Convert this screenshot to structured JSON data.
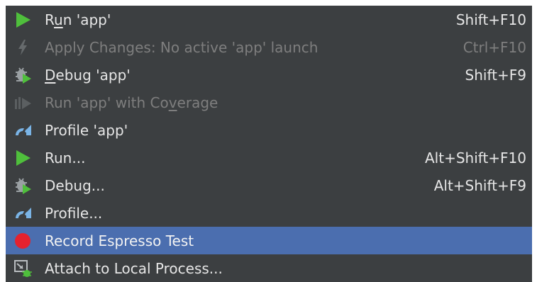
{
  "menu": {
    "items": [
      {
        "name": "run-app",
        "icon": "run-icon",
        "pre": "R",
        "mnemonic": "u",
        "post": "n 'app'",
        "shortcut": "Shift+F10",
        "disabled": false,
        "selected": false
      },
      {
        "name": "apply-changes",
        "icon": "apply-changes-icon",
        "pre": "Apply Changes: No active 'app' launch",
        "mnemonic": "",
        "post": "",
        "shortcut": "Ctrl+F10",
        "disabled": true,
        "selected": false
      },
      {
        "name": "debug-app",
        "icon": "debug-icon",
        "pre": "",
        "mnemonic": "D",
        "post": "ebug 'app'",
        "shortcut": "Shift+F9",
        "disabled": false,
        "selected": false
      },
      {
        "name": "run-with-coverage",
        "icon": "coverage-icon",
        "pre": "Run 'app' with Co",
        "mnemonic": "v",
        "post": "erage",
        "shortcut": "",
        "disabled": true,
        "selected": false
      },
      {
        "name": "profile-app",
        "icon": "profile-icon",
        "pre": "Profile 'app'",
        "mnemonic": "",
        "post": "",
        "shortcut": "",
        "disabled": false,
        "selected": false
      },
      {
        "name": "run-dots",
        "icon": "run-icon",
        "pre": "Run...",
        "mnemonic": "",
        "post": "",
        "shortcut": "Alt+Shift+F10",
        "disabled": false,
        "selected": false
      },
      {
        "name": "debug-dots",
        "icon": "debug-icon",
        "pre": "Debug...",
        "mnemonic": "",
        "post": "",
        "shortcut": "Alt+Shift+F9",
        "disabled": false,
        "selected": false
      },
      {
        "name": "profile-dots",
        "icon": "profile-icon",
        "pre": "Profile...",
        "mnemonic": "",
        "post": "",
        "shortcut": "",
        "disabled": false,
        "selected": false
      },
      {
        "name": "record-espresso-test",
        "icon": "record-icon",
        "pre": "Record Espresso Test",
        "mnemonic": "",
        "post": "",
        "shortcut": "",
        "disabled": false,
        "selected": true
      },
      {
        "name": "attach-to-local-process",
        "icon": "attach-process-icon",
        "pre": "Attach to Local Process...",
        "mnemonic": "",
        "post": "",
        "shortcut": "",
        "disabled": false,
        "selected": false
      }
    ]
  },
  "colors": {
    "menu_background": "#3c3f41",
    "selection": "#4b6eaf",
    "text": "#e6e6e6",
    "disabled_text": "#7e7e7e",
    "run_green": "#4fbf3c",
    "record_red": "#e4222e",
    "profile_blue": "#7ab4e6"
  }
}
